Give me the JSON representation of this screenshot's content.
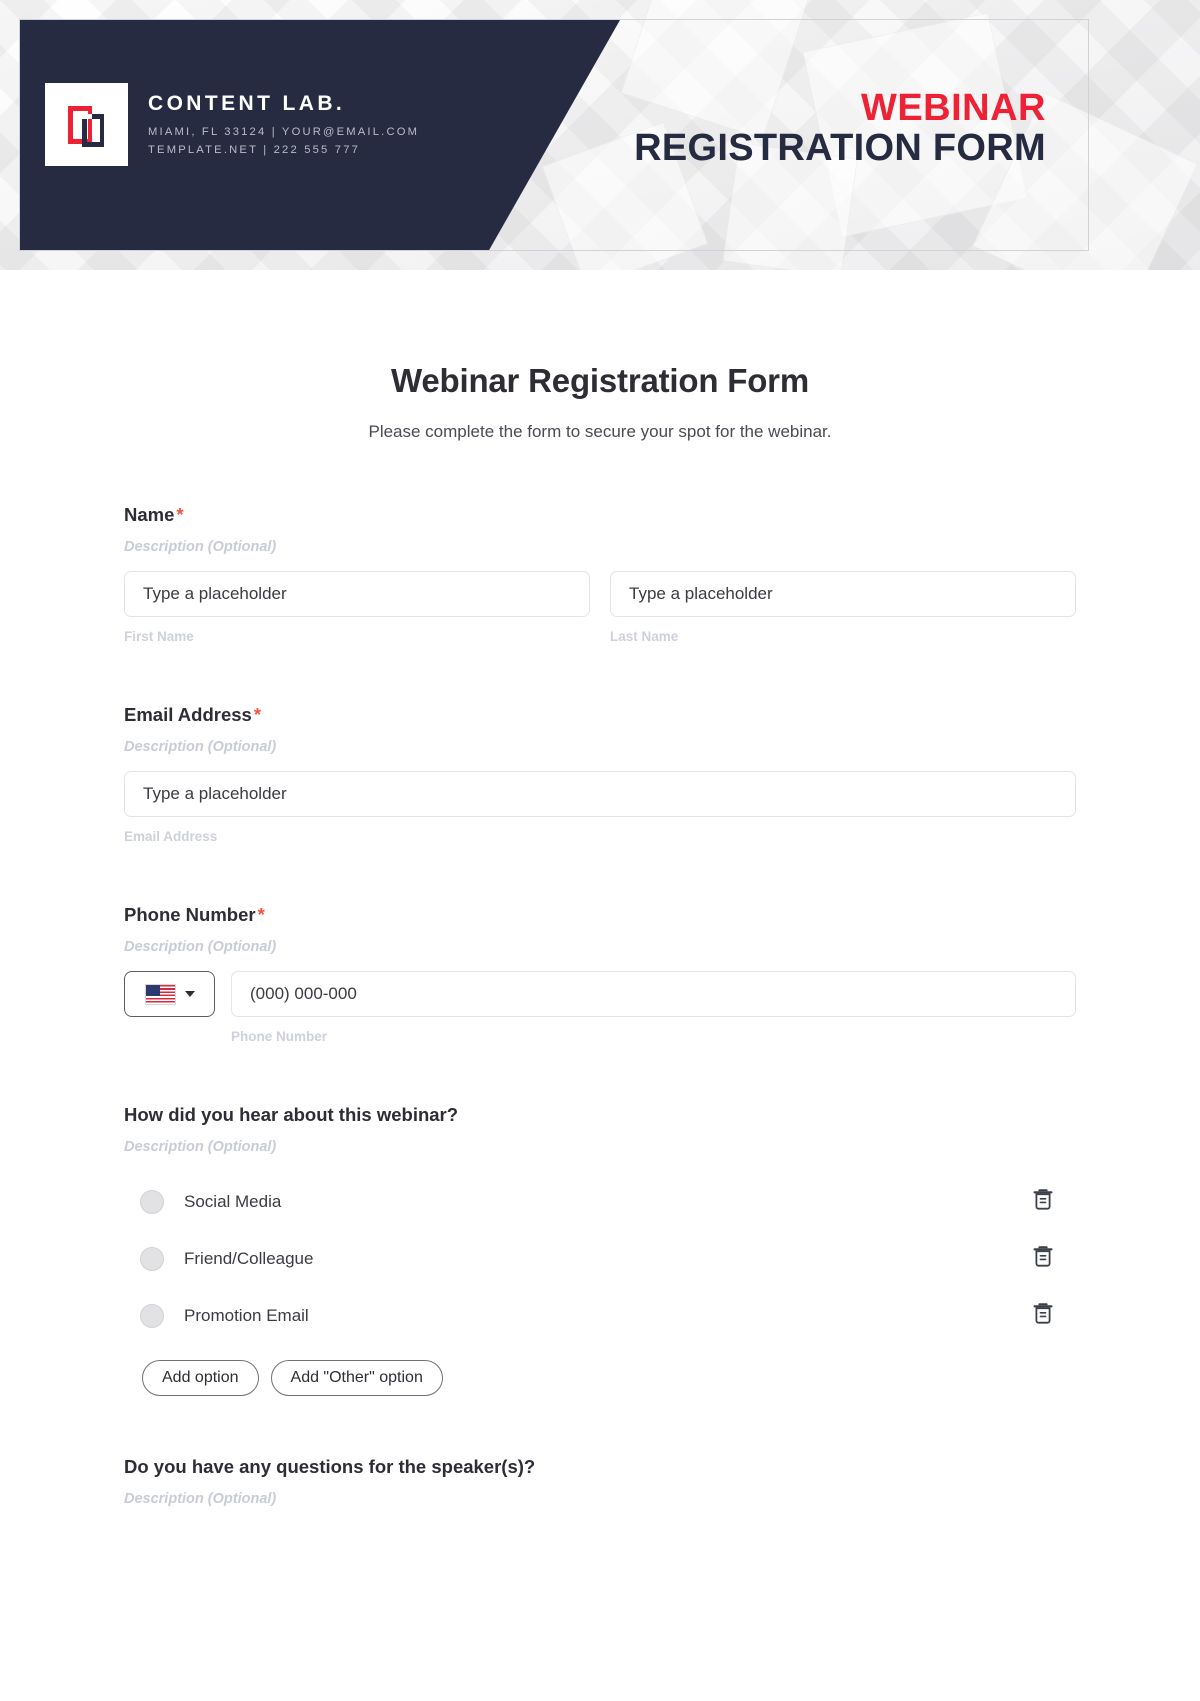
{
  "banner": {
    "brand_name": "CONTENT LAB.",
    "brand_contact_line1": "MIAMI, FL 33124 | YOUR@EMAIL.COM",
    "brand_contact_line2": "TEMPLATE.NET | 222 555 777",
    "title_line1": "WEBINAR",
    "title_line2": "REGISTRATION FORM",
    "accent_red": "#ef2134",
    "dark_navy": "#262b42"
  },
  "form": {
    "title": "Webinar Registration Form",
    "subtitle": "Please complete the form to secure your spot for the webinar.",
    "required_marker": "*",
    "description_placeholder": "Description (Optional)",
    "fields": {
      "name": {
        "label": "Name",
        "description": "Description (Optional)",
        "first": {
          "placeholder": "Type a placeholder",
          "value": "",
          "sub_label": "First Name"
        },
        "last": {
          "placeholder": "Type a placeholder",
          "value": "",
          "sub_label": "Last Name"
        }
      },
      "email": {
        "label": "Email Address",
        "description": "Description (Optional)",
        "placeholder": "Type a placeholder",
        "value": "",
        "sub_label": "Email Address"
      },
      "phone": {
        "label": "Phone Number",
        "description": "Description (Optional)",
        "country": "US",
        "placeholder": "(000) 000-000",
        "value": "",
        "sub_label": "Phone Number"
      },
      "hear_about": {
        "label": "How did you hear about this webinar?",
        "description": "Description (Optional)",
        "options": [
          {
            "label": "Social Media",
            "selected": false
          },
          {
            "label": "Friend/Colleague",
            "selected": false
          },
          {
            "label": "Promotion Email",
            "selected": false
          }
        ],
        "add_option_label": "Add option",
        "add_other_label": "Add \"Other\" option"
      },
      "questions": {
        "label": "Do you have any questions for the speaker(s)?",
        "description": "Description (Optional)"
      }
    }
  }
}
